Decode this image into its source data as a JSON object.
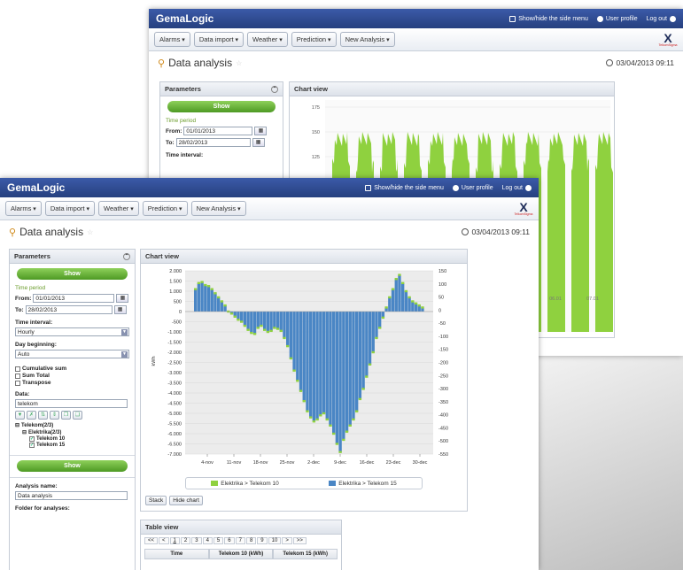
{
  "app": {
    "brand": "GemaLogic",
    "show_hide_menu": "Show/hide the side menu",
    "user_profile": "User profile",
    "logout": "Log out",
    "logo_mark": "X",
    "logo_text": "TelkomSigma"
  },
  "menus": [
    "Alarms",
    "Data import",
    "Weather",
    "Prediction",
    "New Analysis"
  ],
  "page": {
    "title": "Data analysis",
    "timestamp": "03/04/2013 09:11"
  },
  "params": {
    "title": "Parameters",
    "show_button": "Show",
    "time_period_label": "Time period",
    "from_label": "From:",
    "from_value": "01/01/2013",
    "to_label": "To:",
    "to_value": "28/02/2013",
    "interval_label": "Time interval:",
    "interval_value": "Hourly",
    "day_begin_label": "Day beginning:",
    "day_begin_value": "Auto",
    "opt_cumulative": "Cumulative sum",
    "opt_sum_total": "Sum Total",
    "opt_transpose": "Transpose",
    "data_label": "Data:",
    "data_value": "telekom",
    "tree_root": "Telekom(2/3)",
    "tree_child": "Elektrika(2/3)",
    "tree_leaf1": "Telekom 10",
    "tree_leaf2": "Telekom 15",
    "analysis_name_label": "Analysis name:",
    "analysis_name_value": "Data analysis",
    "folder_label": "Folder for analyses:"
  },
  "back_params": {
    "time_period_label": "Time period",
    "from_label": "From:",
    "from_value": "01/01/2013",
    "to_label": "To:",
    "to_value": "28/02/2013",
    "interval_label": "Time interval:"
  },
  "chart_panel": {
    "title": "Chart view",
    "stack_button": "Stack",
    "hide_chart_button": "Hide chart"
  },
  "table_panel": {
    "title": "Table view",
    "pager": [
      "<<",
      "<",
      "1",
      "2",
      "3",
      "4",
      "5",
      "6",
      "7",
      "8",
      "9",
      "10",
      ">",
      ">>"
    ],
    "columns": [
      "Time",
      "Telekom 10 (kWh)",
      "Telekom 15 (kWh)"
    ]
  },
  "colors": {
    "series1": "#8fd13f",
    "series2": "#4a86c5",
    "accent": "#2a4a96"
  },
  "chart_data": [
    {
      "type": "bar",
      "title": "",
      "xlabel": "",
      "ylabel": "kWh",
      "ylim": [
        -7000,
        2000
      ],
      "y2lim": [
        -550,
        150
      ],
      "yticks": [
        "2.000",
        "1.500",
        "1.000",
        "500",
        "0",
        "-500",
        "-1.000",
        "-1.500",
        "-2.000",
        "-2.500",
        "-3.000",
        "-3.500",
        "-4.000",
        "-4.500",
        "-5.000",
        "-5.500",
        "-6.000",
        "-6.500",
        "-7.000"
      ],
      "y2ticks": [
        "150",
        "100",
        "50",
        "0",
        "-50",
        "-100",
        "-150",
        "-200",
        "-250",
        "-300",
        "-350",
        "-400",
        "-450",
        "-500",
        "-550"
      ],
      "xticks": [
        "4-nov",
        "11-nov",
        "18-nov",
        "25-nov",
        "2-dec",
        "9-dec",
        "16-dec",
        "23-dec",
        "30-dec"
      ],
      "grid": true,
      "legend_position": "bottom",
      "series": [
        {
          "name": "Elektrika > Telekom 10",
          "color": "#8fd13f"
        },
        {
          "name": "Elektrika > Telekom 15",
          "color": "#4a86c5"
        }
      ],
      "values": [
        1100,
        1400,
        1450,
        1300,
        1250,
        1100,
        900,
        700,
        500,
        300,
        0,
        -100,
        -250,
        -400,
        -500,
        -700,
        -900,
        -1050,
        -1100,
        -800,
        -700,
        -900,
        -1000,
        -950,
        -800,
        -850,
        -950,
        -1300,
        -1700,
        -2300,
        -2900,
        -3400,
        -3900,
        -4400,
        -4900,
        -5200,
        -5400,
        -5300,
        -5100,
        -5000,
        -5300,
        -5600,
        -6000,
        -6500,
        -6900,
        -6300,
        -5900,
        -5600,
        -5300,
        -4900,
        -4300,
        -3800,
        -3200,
        -2600,
        -2000,
        -1300,
        -800,
        -300,
        200,
        700,
        1100,
        1600,
        1800,
        1400,
        1000,
        700,
        500,
        400,
        300,
        200
      ],
      "x_start": "1-nov",
      "x_end": "5-jan"
    },
    {
      "type": "area",
      "title": "",
      "yticks": [
        "175",
        "150",
        "125"
      ],
      "xticks": [
        "06.01",
        "07.01"
      ],
      "series": [
        {
          "name": "",
          "color": "#8fd13f"
        }
      ]
    }
  ]
}
